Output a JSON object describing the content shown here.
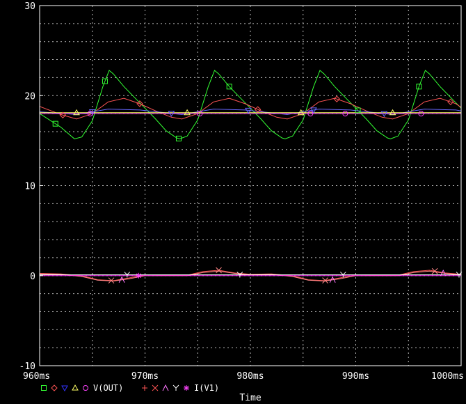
{
  "chart_data": {
    "type": "line",
    "title": "",
    "xlabel": "Time",
    "ylabel": "",
    "xlim": [
      960,
      1000
    ],
    "ylim": [
      -10,
      30
    ],
    "x_ticks": [
      960,
      970,
      980,
      990,
      1000
    ],
    "x_tick_labels": [
      "960ms",
      "970ms",
      "980ms",
      "990ms",
      "1000ms"
    ],
    "y_ticks": [
      -10,
      0,
      10,
      20,
      30
    ],
    "y_tick_labels": [
      "-10",
      "0",
      "10",
      "20",
      "30"
    ],
    "grid": true,
    "legend_position": "bottom-left",
    "legend_groups": [
      {
        "label": "V(OUT)",
        "markers": [
          "square",
          "diamond",
          "triangle-down",
          "triangle-up",
          "circle"
        ],
        "colors": [
          "#33ff33",
          "#ff5555",
          "#3333ff",
          "#ffff66",
          "#ff44ff"
        ]
      },
      {
        "label": "I(V1)",
        "markers": [
          "plus",
          "x",
          "lambda",
          "y",
          "asterisk"
        ],
        "colors": [
          "#ff5555",
          "#ff5555",
          "#ff77ff",
          "#ffffff",
          "#ff44ff"
        ]
      }
    ],
    "series": [
      {
        "color": "#33ff33",
        "x": [
          960,
          962,
          963.3,
          964,
          965,
          966,
          966.6,
          967,
          968,
          969,
          970,
          971,
          972,
          973,
          973.3,
          974,
          975,
          976,
          976.6,
          977,
          978,
          979,
          980,
          981,
          982,
          983,
          983.3,
          984,
          985,
          986,
          986.6,
          987,
          988,
          989,
          990,
          991,
          992,
          993,
          993.3,
          994,
          995,
          996,
          996.6,
          997,
          998,
          999,
          1000
        ],
        "y": [
          18,
          16.5,
          15.2,
          15.4,
          17.2,
          21,
          22.8,
          22.4,
          21,
          19.8,
          18.6,
          17.4,
          16.1,
          15.3,
          15.2,
          15.5,
          17.3,
          21,
          22.8,
          22.4,
          21,
          19.8,
          18.6,
          17.4,
          16.1,
          15.3,
          15.2,
          15.5,
          17.3,
          21,
          22.8,
          22.4,
          21,
          19.8,
          18.6,
          17.4,
          16.1,
          15.3,
          15.2,
          15.5,
          17.3,
          21,
          22.8,
          22.4,
          21,
          19.8,
          18.6
        ]
      },
      {
        "color": "#ff5555",
        "x": [
          960,
          962,
          963.5,
          965,
          966.5,
          968,
          969.5,
          971,
          972.5,
          973.5,
          975,
          976.5,
          978,
          979.5,
          981,
          982.5,
          983.5,
          985,
          986.5,
          988,
          989.5,
          991,
          992.5,
          993.5,
          995,
          996.5,
          998,
          999.5,
          1000
        ],
        "y": [
          18.8,
          17.9,
          17.4,
          18.0,
          19.3,
          19.7,
          19.1,
          18.3,
          17.6,
          17.4,
          18.0,
          19.3,
          19.7,
          19.1,
          18.3,
          17.6,
          17.4,
          18.0,
          19.3,
          19.7,
          19.1,
          18.3,
          17.6,
          17.4,
          18.0,
          19.3,
          19.7,
          19.1,
          18.7
        ]
      },
      {
        "color": "#6666ff",
        "x": [
          960,
          963.5,
          966.5,
          969.5,
          973.5,
          976.5,
          979.5,
          983.5,
          986.5,
          989.5,
          993.5,
          996.5,
          999.5,
          1000
        ],
        "y": [
          18.2,
          17.9,
          18.5,
          18.4,
          17.9,
          18.5,
          18.4,
          17.9,
          18.5,
          18.4,
          17.9,
          18.5,
          18.4,
          18.3
        ]
      },
      {
        "color": "#ffff66",
        "x": [
          960,
          1000
        ],
        "y": [
          18.1,
          18.1
        ]
      },
      {
        "color": "#ff44ff",
        "x": [
          960,
          1000
        ],
        "y": [
          18.0,
          18.0
        ]
      },
      {
        "color": "#ff5555",
        "x": [
          960,
          962,
          964,
          965.5,
          967,
          968.5,
          970,
          972,
          974,
          975.5,
          977,
          978.5,
          980,
          982,
          984,
          985.5,
          987,
          988.5,
          990,
          992,
          994,
          995.5,
          997,
          998.5,
          1000
        ],
        "y": [
          0.25,
          0.2,
          0,
          -0.45,
          -0.55,
          -0.25,
          0.1,
          0.05,
          0.05,
          0.45,
          0.6,
          0.3,
          0.15,
          0.2,
          0,
          -0.45,
          -0.55,
          -0.25,
          0.1,
          0.05,
          0.05,
          0.45,
          0.6,
          0.3,
          0.15
        ]
      },
      {
        "color": "#ff8888",
        "x": [
          960,
          962,
          964,
          965.5,
          967,
          968.5,
          970,
          972,
          974,
          975.5,
          977,
          978.5,
          980,
          982,
          984,
          985.5,
          987,
          988.5,
          990,
          992,
          994,
          995.5,
          997,
          998.5,
          1000
        ],
        "y": [
          0.2,
          0.15,
          -0.1,
          -0.5,
          -0.6,
          -0.35,
          0.0,
          0.0,
          0.0,
          0.35,
          0.5,
          0.25,
          0.1,
          0.15,
          -0.1,
          -0.5,
          -0.6,
          -0.35,
          0.0,
          0.0,
          0.0,
          0.35,
          0.5,
          0.25,
          0.1
        ]
      },
      {
        "color": "#ffffff",
        "x": [
          960,
          1000
        ],
        "y": [
          0.1,
          0.1
        ]
      },
      {
        "color": "#ff44ff",
        "x": [
          960,
          1000
        ],
        "y": [
          0.0,
          0.0
        ]
      }
    ],
    "markers": [
      {
        "series": 0,
        "shape": "square",
        "color": "#33ff33",
        "x": [
          961.5,
          966.2,
          973.2,
          978.0,
          990.2,
          996.0
        ]
      },
      {
        "series": 1,
        "shape": "diamond",
        "color": "#ff5555",
        "x": [
          962.2,
          969.5,
          980.7,
          988.2,
          999.0
        ]
      },
      {
        "series": 2,
        "shape": "triangle-down",
        "color": "#6666ff",
        "x": [
          965.0,
          972.5,
          979.8,
          986.0,
          992.7
        ]
      },
      {
        "series": 3,
        "shape": "triangle-up",
        "color": "#ffff66",
        "x": [
          963.5,
          974.0,
          984.8,
          993.5
        ]
      },
      {
        "series": 4,
        "shape": "circle",
        "color": "#ff44ff",
        "x": [
          964.8,
          975.2,
          985.7,
          989.0,
          996.2
        ]
      },
      {
        "series": 5,
        "shape": "x",
        "color": "#ff8888",
        "x": [
          966.8,
          977.0,
          987.1,
          997.5
        ]
      },
      {
        "series": 6,
        "shape": "lambda",
        "color": "#ff77ff",
        "x": [
          967.8,
          987.8,
          998.3
        ]
      },
      {
        "series": 7,
        "shape": "y",
        "color": "#ffffff",
        "x": [
          968.3,
          979.0,
          988.8,
          999.8
        ]
      },
      {
        "series": 8,
        "shape": "asterisk",
        "color": "#ff44ff",
        "x": [
          969.4
        ]
      }
    ]
  }
}
